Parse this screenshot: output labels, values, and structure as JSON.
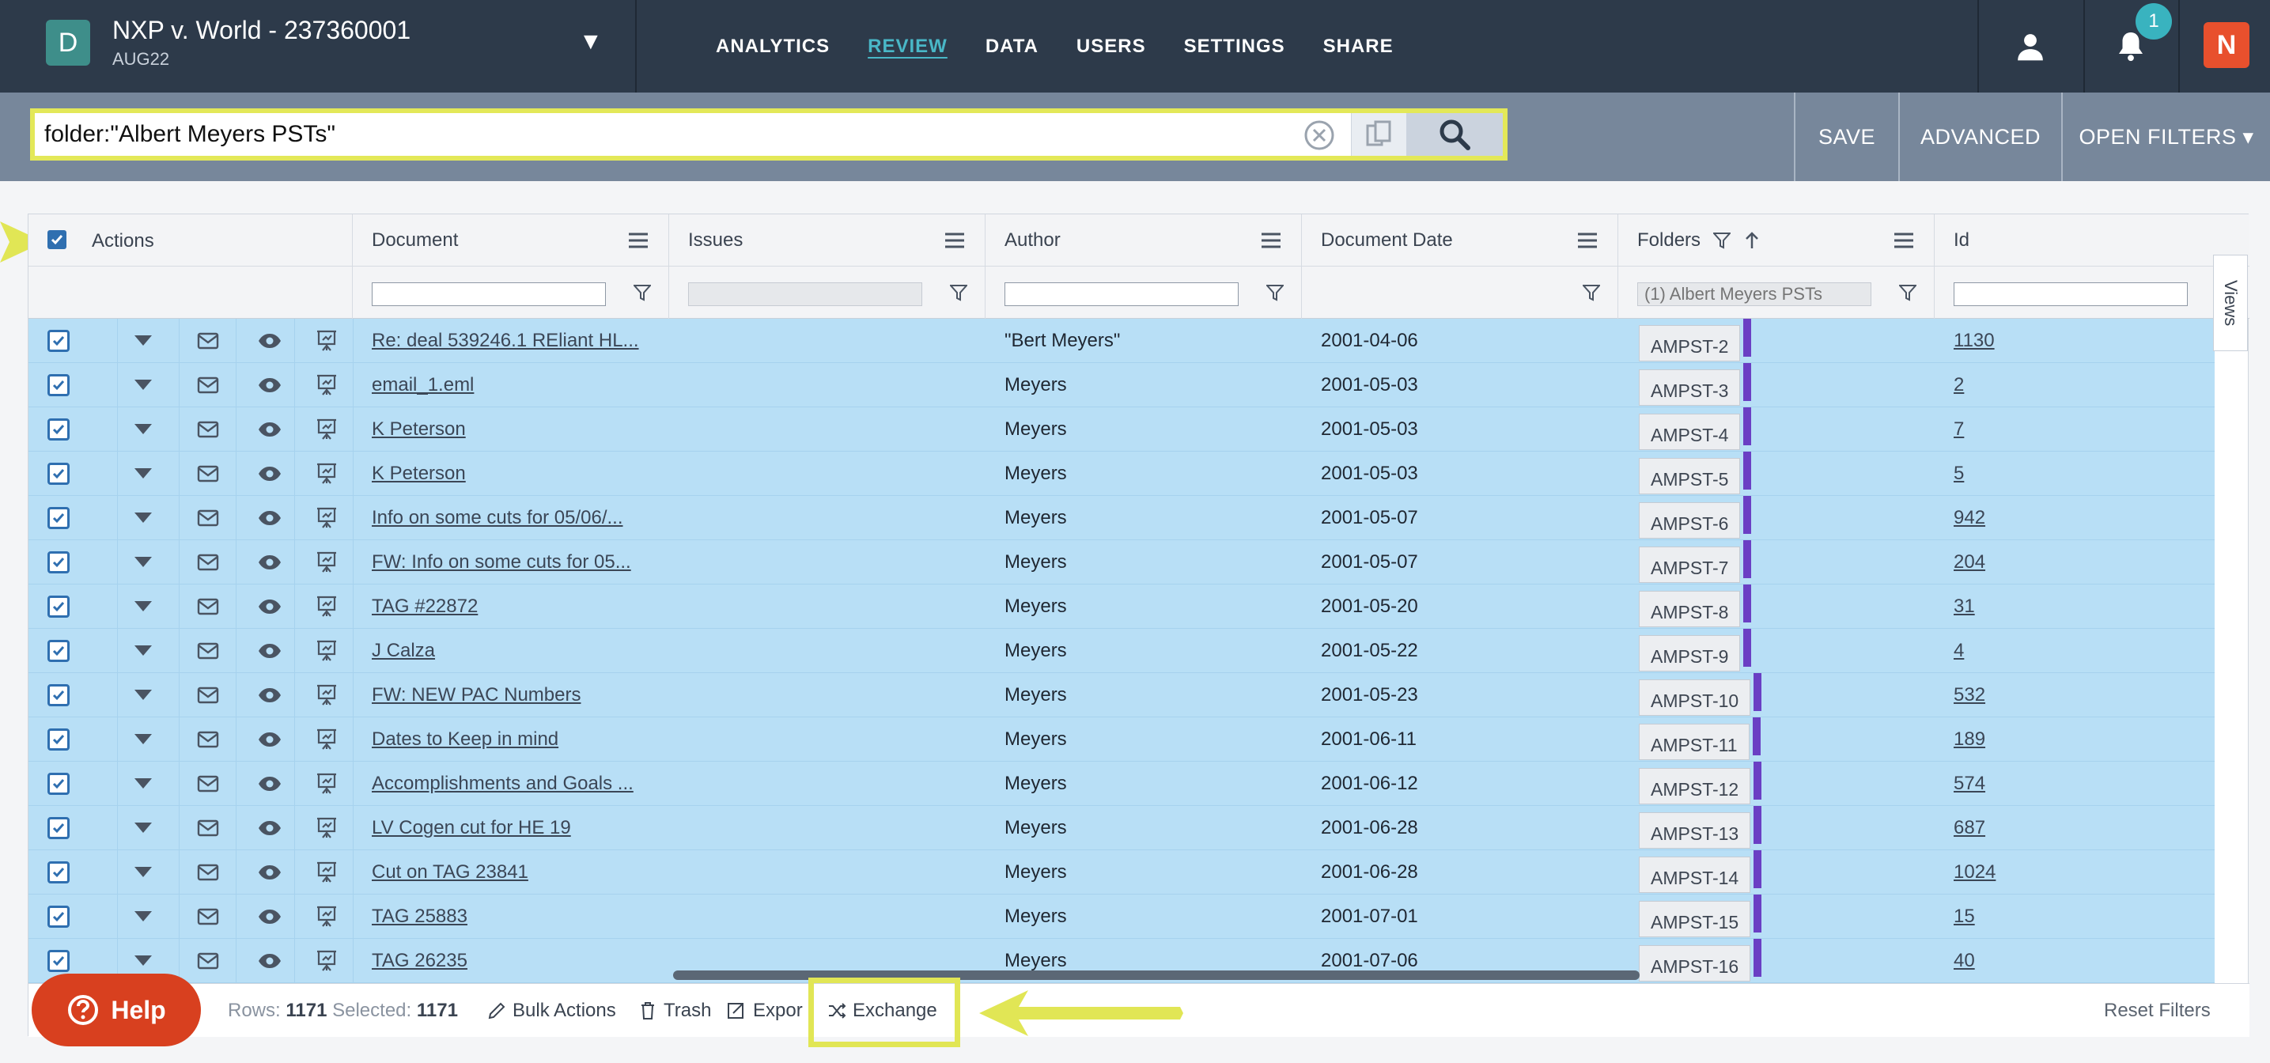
{
  "app": {
    "case_initial": "D",
    "case_title": "NXP v. World - 237360001",
    "case_subtitle": "AUG22",
    "dropdown_glyph": "▼",
    "notification_count": "1",
    "brand_glyph": "N",
    "nav": [
      {
        "label": "ANALYTICS",
        "active": false
      },
      {
        "label": "REVIEW",
        "active": true
      },
      {
        "label": "DATA",
        "active": false
      },
      {
        "label": "USERS",
        "active": false
      },
      {
        "label": "SETTINGS",
        "active": false
      },
      {
        "label": "SHARE",
        "active": false
      }
    ]
  },
  "search": {
    "query": "folder:\"Albert Meyers PSTs\"",
    "save_label": "SAVE",
    "advanced_label": "ADVANCED",
    "open_filters_label": "OPEN FILTERS ▾"
  },
  "grid": {
    "columns": {
      "actions": "Actions",
      "document": "Document",
      "issues": "Issues",
      "author": "Author",
      "document_date": "Document Date",
      "folders": "Folders",
      "id": "Id"
    },
    "folder_filter_placeholder": "(1) Albert Meyers PSTs",
    "views_label": "Views",
    "rows": [
      {
        "document": "Re: deal 539246.1 REliant HL...",
        "author": "\"Bert Meyers\"",
        "date": "2001-04-06",
        "folder": "AMPST-2",
        "id": "1130"
      },
      {
        "document": "email_1.eml",
        "author": "Meyers",
        "date": "2001-05-03",
        "folder": "AMPST-3",
        "id": "2"
      },
      {
        "document": "K Peterson",
        "author": "Meyers",
        "date": "2001-05-03",
        "folder": "AMPST-4",
        "id": "7"
      },
      {
        "document": "K Peterson",
        "author": "Meyers",
        "date": "2001-05-03",
        "folder": "AMPST-5",
        "id": "5"
      },
      {
        "document": "Info on some cuts for 05/06/...",
        "author": "Meyers",
        "date": "2001-05-07",
        "folder": "AMPST-6",
        "id": "942"
      },
      {
        "document": "FW: Info on some cuts for 05...",
        "author": "Meyers",
        "date": "2001-05-07",
        "folder": "AMPST-7",
        "id": "204"
      },
      {
        "document": "TAG #22872",
        "author": "Meyers",
        "date": "2001-05-20",
        "folder": "AMPST-8",
        "id": "31"
      },
      {
        "document": "J Calza",
        "author": "Meyers",
        "date": "2001-05-22",
        "folder": "AMPST-9",
        "id": "4"
      },
      {
        "document": "FW: NEW PAC Numbers",
        "author": "Meyers",
        "date": "2001-05-23",
        "folder": "AMPST-10",
        "id": "532"
      },
      {
        "document": "Dates to Keep in mind",
        "author": "Meyers",
        "date": "2001-06-11",
        "folder": "AMPST-11",
        "id": "189"
      },
      {
        "document": "Accomplishments and Goals ...",
        "author": "Meyers",
        "date": "2001-06-12",
        "folder": "AMPST-12",
        "id": "574"
      },
      {
        "document": "LV Cogen cut for HE 19",
        "author": "Meyers",
        "date": "2001-06-28",
        "folder": "AMPST-13",
        "id": "687"
      },
      {
        "document": "Cut on TAG 23841",
        "author": "Meyers",
        "date": "2001-06-28",
        "folder": "AMPST-14",
        "id": "1024"
      },
      {
        "document": "TAG 25883",
        "author": "Meyers",
        "date": "2001-07-01",
        "folder": "AMPST-15",
        "id": "15"
      },
      {
        "document": "TAG 26235",
        "author": "Meyers",
        "date": "2001-07-06",
        "folder": "AMPST-16",
        "id": "40"
      }
    ]
  },
  "footer": {
    "help_label": "Help",
    "rows_label": "Rows:",
    "rows_count": "1171",
    "selected_label": "Selected:",
    "selected_count": "1171",
    "bulk_actions": "Bulk Actions",
    "trash": "Trash",
    "export": "Expor",
    "exchange": "Exchange",
    "reset_filters": "Reset Filters"
  },
  "colors": {
    "topbar": "#2d3a4a",
    "accent": "#49b7c7",
    "selected_row": "#b8dff6",
    "highlight": "#e1e655",
    "folder_bar": "#6a3fc4",
    "help": "#d8401f"
  }
}
